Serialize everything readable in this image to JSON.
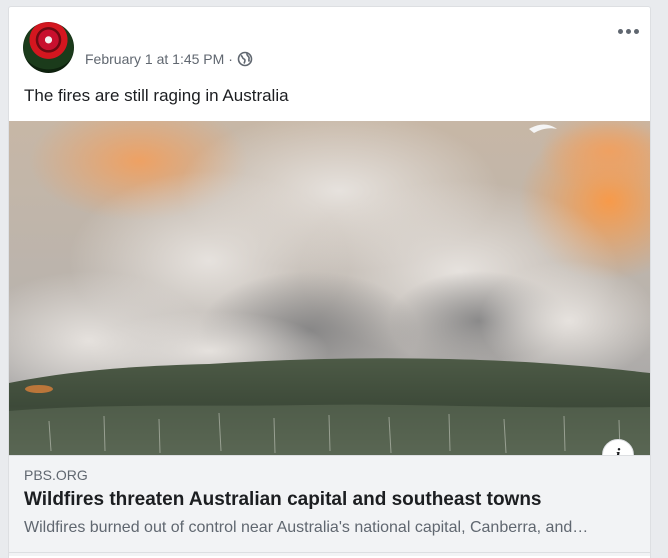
{
  "post": {
    "timestamp": "February 1 at 1:45 PM",
    "separator": "·",
    "privacy_icon": "globe-icon",
    "more_icon": "more-options-icon",
    "text": "The fires are still raging in Australia"
  },
  "link_preview": {
    "domain": "PBS.ORG",
    "title": "Wildfires threaten Australian capital and southeast towns",
    "description": "Wildfires burned out of control near Australia's national capital, Canberra, and…",
    "info_icon": "info-icon",
    "info_label": "i"
  },
  "colors": {
    "background": "#e9ebee",
    "card": "#ffffff",
    "secondary_text": "#606770",
    "primary_text": "#1c1e21",
    "link_box": "#f2f3f5"
  }
}
